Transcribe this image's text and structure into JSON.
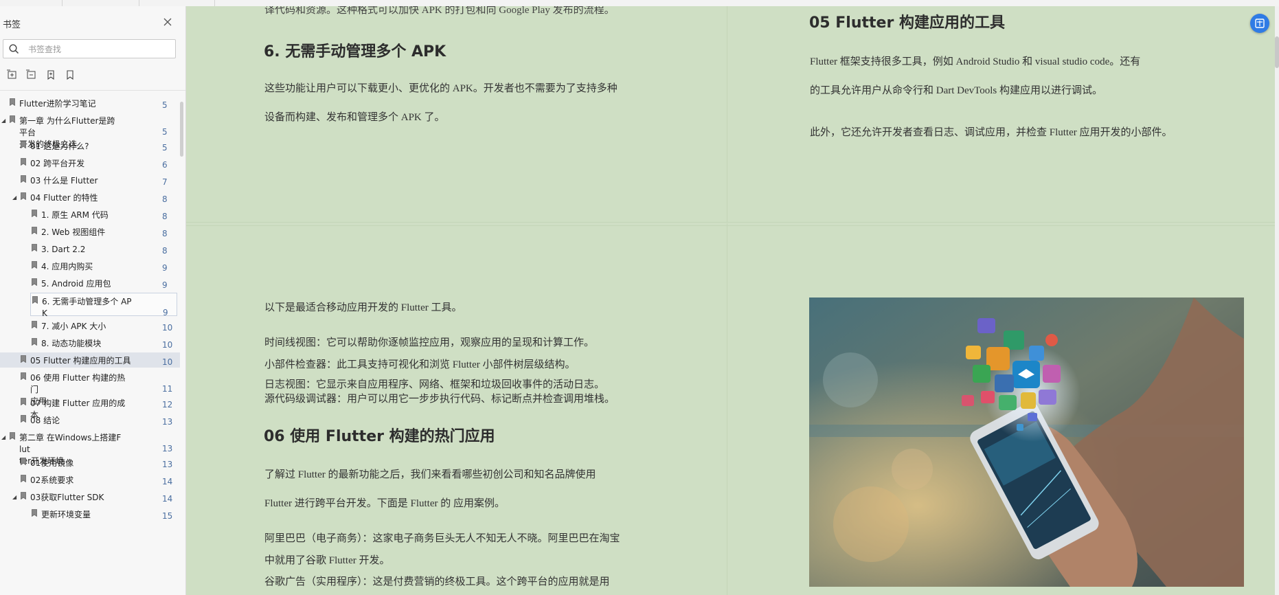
{
  "sidebar": {
    "title": "书签",
    "search_placeholder": "书签查找",
    "tool_icons": [
      "expand-all-icon",
      "collapse-all-icon",
      "add-bookmark-icon",
      "bookmark-icon"
    ],
    "items": [
      {
        "label": "Flutter进阶学习笔记",
        "page": "5",
        "level": 0,
        "arrow": false
      },
      {
        "label": "第一章 为什么Flutter是跨平台\n开发的终极之选",
        "page": "5",
        "level": 0,
        "arrow": true
      },
      {
        "label": "01 这是为什么?",
        "page": "5",
        "level": 1,
        "arrow": false
      },
      {
        "label": "02 跨平台开发",
        "page": "6",
        "level": 1,
        "arrow": false
      },
      {
        "label": "03 什么是 Flutter",
        "page": "7",
        "level": 1,
        "arrow": false
      },
      {
        "label": "04 Flutter 的特性",
        "page": "8",
        "level": 1,
        "arrow": true
      },
      {
        "label": "1. 原生 ARM 代码",
        "page": "8",
        "level": 2,
        "arrow": false
      },
      {
        "label": "2. Web 视图组件",
        "page": "8",
        "level": 2,
        "arrow": false
      },
      {
        "label": "3. Dart 2.2",
        "page": "8",
        "level": 2,
        "arrow": false
      },
      {
        "label": "4. 应用内购买",
        "page": "9",
        "level": 2,
        "arrow": false
      },
      {
        "label": "5. Android 应用包",
        "page": "9",
        "level": 2,
        "arrow": false
      },
      {
        "label": "6. 无需手动管理多个 AP\nK",
        "page": "9",
        "level": 2,
        "arrow": false,
        "state": "selected"
      },
      {
        "label": "7. 减小 APK 大小",
        "page": "10",
        "level": 2,
        "arrow": false
      },
      {
        "label": "8. 动态功能模块",
        "page": "10",
        "level": 2,
        "arrow": false
      },
      {
        "label": "05 Flutter 构建应用的工具",
        "page": "10",
        "level": 1,
        "arrow": false,
        "state": "current"
      },
      {
        "label": "06 使用 Flutter 构建的热门\n应用",
        "page": "11",
        "level": 1,
        "arrow": false
      },
      {
        "label": "07 构建 Flutter 应用的成本",
        "page": "12",
        "level": 1,
        "arrow": false
      },
      {
        "label": "08 结论",
        "page": "13",
        "level": 1,
        "arrow": false
      },
      {
        "label": "第二章 在Windows上搭建Flut\nter开发环境",
        "page": "13",
        "level": 0,
        "arrow": true
      },
      {
        "label": "01使用镜像",
        "page": "13",
        "level": 1,
        "arrow": false
      },
      {
        "label": "02系统要求",
        "page": "14",
        "level": 1,
        "arrow": false
      },
      {
        "label": "03获取Flutter SDK",
        "page": "14",
        "level": 1,
        "arrow": true
      },
      {
        "label": "更新环境变量",
        "page": "15",
        "level": 2,
        "arrow": false
      }
    ]
  },
  "document": {
    "left_page_top": {
      "cut_line": "译代码和资源。这种格式可以加快 APK 的打包和向 Google Play 发布的流程。",
      "heading": "6. 无需手动管理多个 APK",
      "lines": [
        "这些功能让用户可以下载更小、更优化的 APK。开发者也不需要为了支持多种",
        "设备而构建、发布和管理多个 APK 了。"
      ]
    },
    "right_page_top": {
      "heading": "05 Flutter 构建应用的工具",
      "lines": [
        "Flutter 框架支持很多工具，例如 Android Studio 和 visual studio code。还有",
        "的工具允许用户从命令行和 Dart DevTools 构建应用以进行调试。",
        "此外，它还允许开发者查看日志、调试应用，并检查 Flutter 应用开发的小部件。"
      ]
    },
    "left_page_bottom": {
      "intro": "以下是最适合移动应用开发的 Flutter 工具。",
      "tools": [
        "时间线视图：它可以帮助你逐帧监控应用，观察应用的呈现和计算工作。",
        "小部件检查器：此工具支持可视化和浏览 Flutter 小部件树层级结构。",
        "日志视图：它显示来自应用程序、网络、框架和垃圾回收事件的活动日志。",
        "源代码级调试器：用户可以用它一步步执行代码、标记断点并检查调用堆栈。"
      ],
      "heading": "06 使用 Flutter 构建的热门应用",
      "lines": [
        "了解过 Flutter 的最新功能之后，我们来看看哪些初创公司和知名品牌使用",
        "Flutter 进行跨平台开发。下面是 Flutter 的 应用案例。",
        "阿里巴巴（电子商务）：这家电子商务巨头无人不知无人不晓。阿里巴巴在淘宝",
        "中就用了谷歌 Flutter 开发。",
        "谷歌广告（实用程序）：这是付费营销的终极工具。这个跨平台的应用就是用"
      ]
    },
    "photo_description_icon": "smartphone-app-icons-photo"
  },
  "colors": {
    "page_bg": "#cfdfc4",
    "accent": "#2f7be5",
    "sidebar_bg": "#f7f7f7",
    "page_number": "#4a6ea0"
  }
}
